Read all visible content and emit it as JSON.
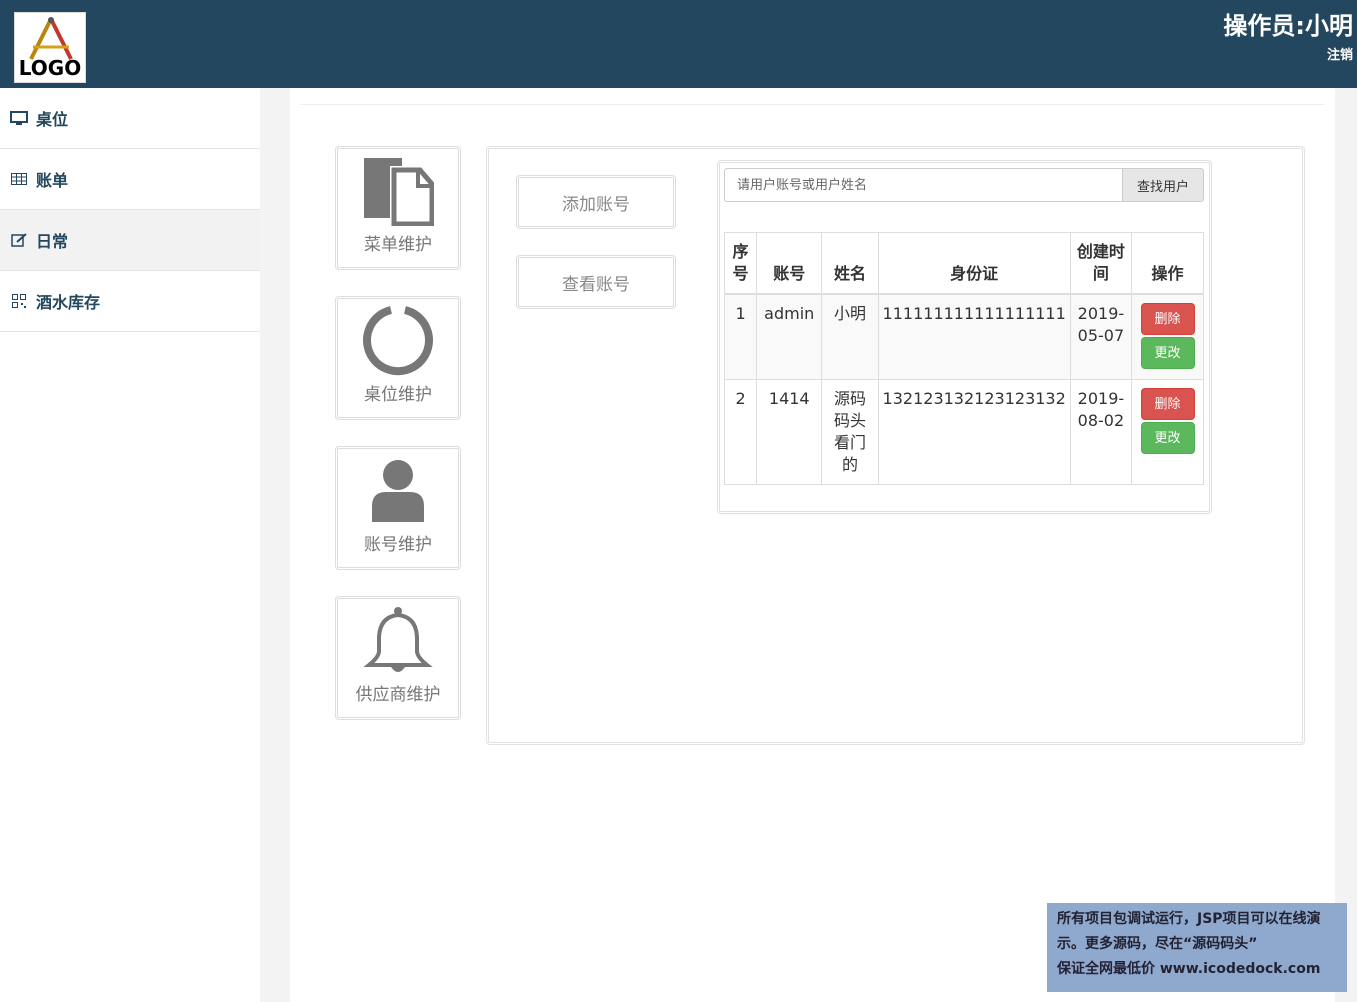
{
  "header": {
    "logo_text": "LOGO",
    "operator": "操作员:小明",
    "logout": "注销"
  },
  "sidebar": {
    "items": [
      {
        "label": "桌位",
        "icon": "monitor-icon"
      },
      {
        "label": "账单",
        "icon": "table-icon"
      },
      {
        "label": "日常",
        "icon": "edit-icon"
      },
      {
        "label": "酒水库存",
        "icon": "qrcode-icon"
      }
    ]
  },
  "tiles": [
    {
      "label": "菜单维护",
      "icon": "files-icon"
    },
    {
      "label": "桌位维护",
      "icon": "ring-icon"
    },
    {
      "label": "账号维护",
      "icon": "user-icon"
    },
    {
      "label": "供应商维护",
      "icon": "bell-icon"
    }
  ],
  "actions": {
    "add_account": "添加账号",
    "view_account": "查看账号"
  },
  "search": {
    "placeholder": "请用户账号或用户姓名",
    "button": "查找用户"
  },
  "table": {
    "headers": [
      "序号",
      "账号",
      "姓名",
      "身份证",
      "创建时间",
      "操作"
    ],
    "rows": [
      {
        "no": "1",
        "account": "admin",
        "name": "小明",
        "id_card": "111111111111111111",
        "created": "2019-05-07"
      },
      {
        "no": "2",
        "account": "1414",
        "name": "源码码头看门的",
        "id_card": "132123132123123132",
        "created": "2019-08-02"
      }
    ],
    "delete_label": "删除",
    "edit_label": "更改"
  },
  "watermark": {
    "line1": "所有项目包调试运行，JSP项目可以在线演",
    "line2": "示。更多源码，尽在“源码码头”",
    "line3": "保证全网最低价 www.icodedock.com"
  },
  "colors": {
    "header_bg": "#23475f",
    "delete": "#d9534f",
    "edit": "#5cb85c",
    "icon_gray": "#777777"
  }
}
